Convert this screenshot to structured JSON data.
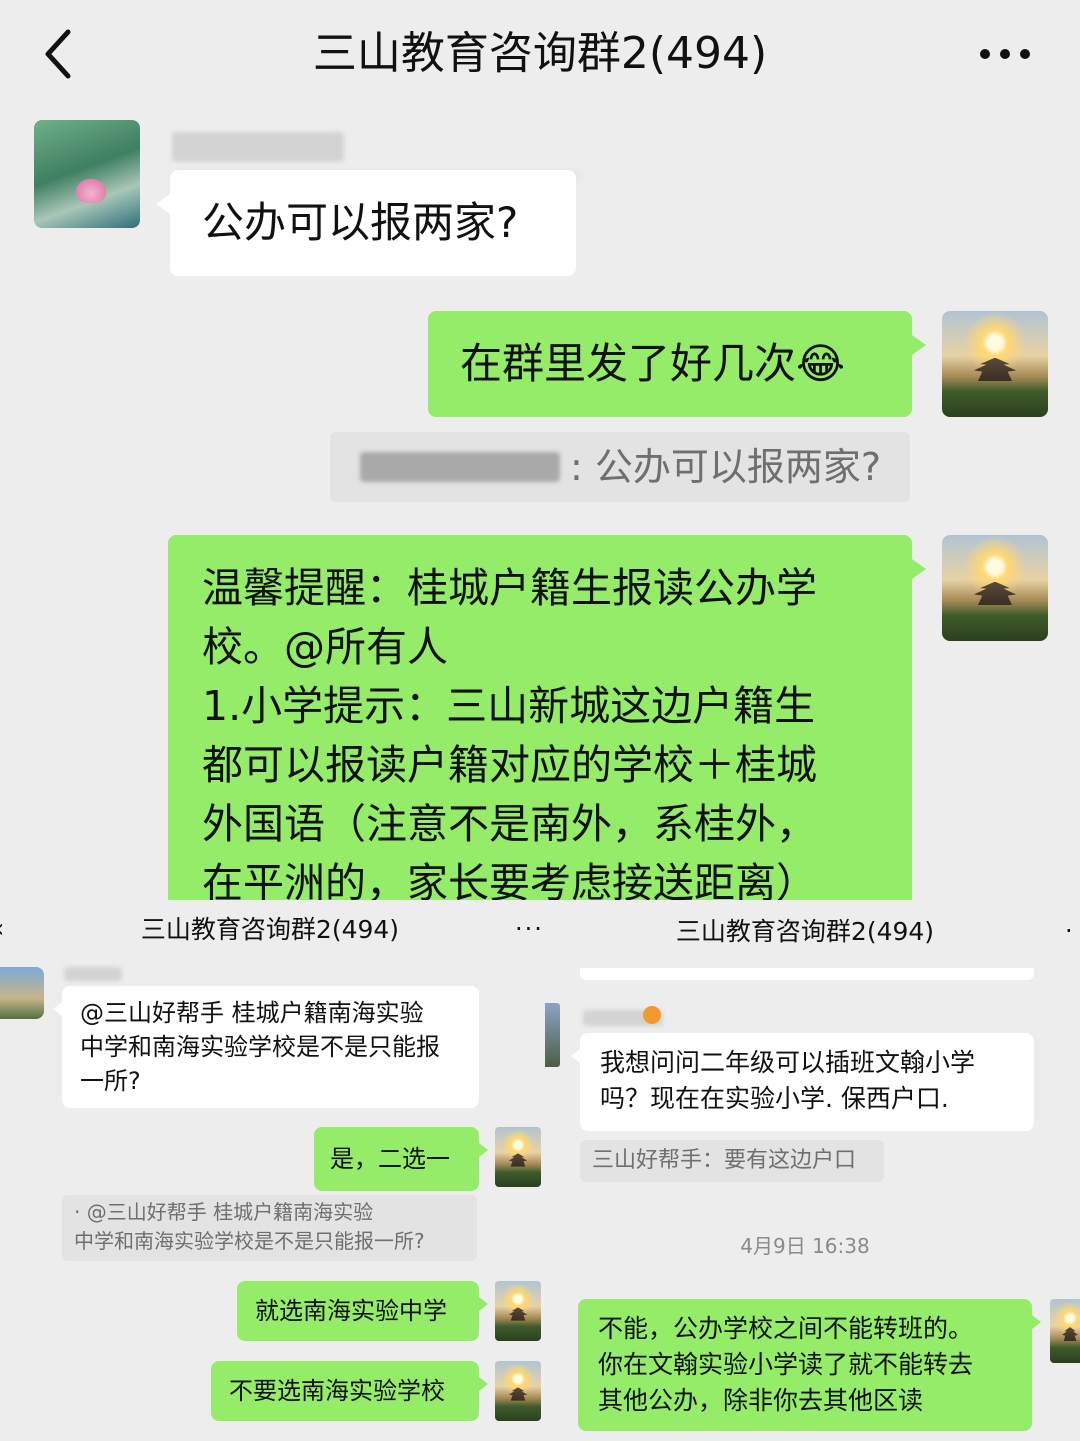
{
  "header": {
    "title": "三山教育咨询群2(494)"
  },
  "main_chat": {
    "msg1": "公办可以报两家?",
    "msg2": "在群里发了好几次😂",
    "quote1": ":  公办可以报两家?",
    "msg3_lines": [
      "温馨提醒：桂城户籍生报读公办学",
      "校。@所有人",
      "1.小学提示：三山新城这边户籍生",
      "都可以报读户籍对应的学校＋桂城",
      "外国语（注意不是南外，系桂外，",
      "在平洲的，家长要考虑接送距离）"
    ]
  },
  "left_panel": {
    "title": "三山教育咨询群2(494)",
    "msg1_lines": [
      "@三山好帮手  桂城户籍南海实验",
      "中学和南海实验学校是不是只能报",
      "一所?"
    ],
    "reply1": "是，二选一",
    "quote_lines": [
      "·  @三山好帮手 桂城户籍南海实验",
      "中学和南海实验学校是不是只能报一所?"
    ],
    "reply2": "就选南海实验中学",
    "reply3": "不要选南海实验学校"
  },
  "right_panel": {
    "title": "三山教育咨询群2(494)",
    "msg1_lines": [
      "我想问问二年级可以插班文翰小学",
      "吗？现在在实验小学. 保西户口."
    ],
    "quote": "三山好帮手：要有这边户口",
    "timestamp": "4月9日 16:38",
    "reply_lines": [
      "不能，公办学校之间不能转班的。",
      "你在文翰实验小学读了就不能转去",
      "其他公办，除非你去其他区读"
    ]
  },
  "colors": {
    "background": "#ededed",
    "bubble_green": "#95ec69",
    "bubble_white": "#ffffff",
    "quote_gray": "#e3e3e3"
  }
}
